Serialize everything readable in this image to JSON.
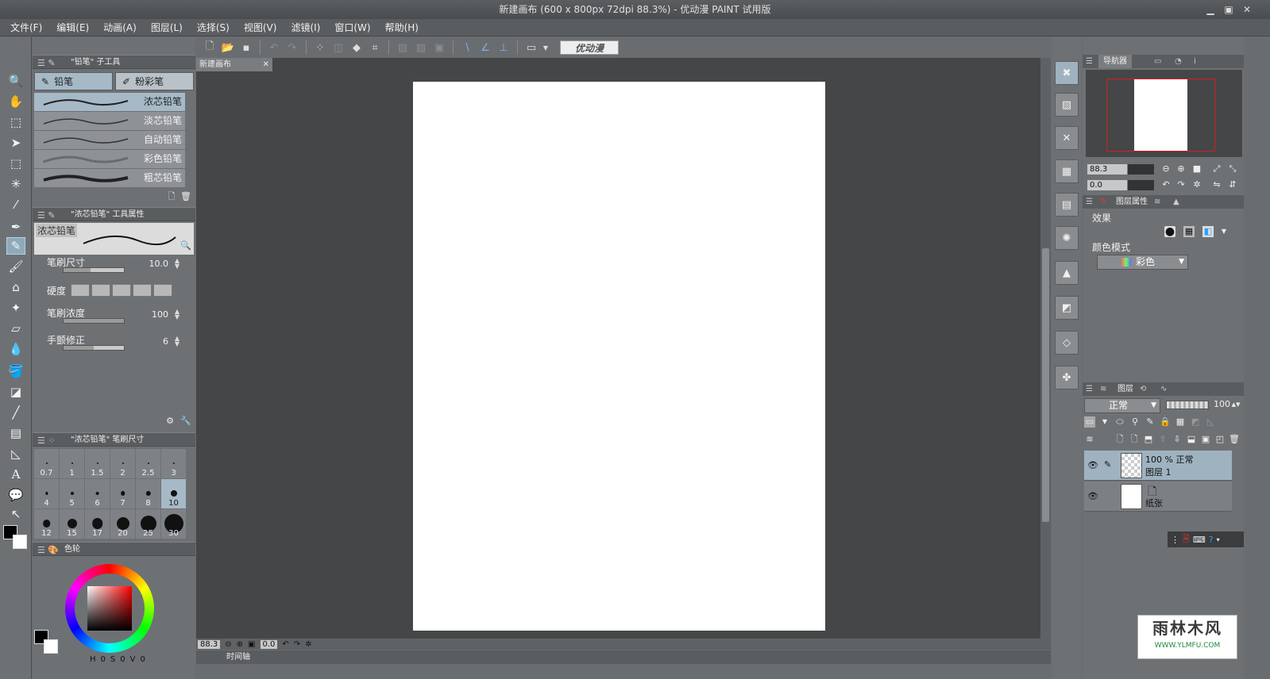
{
  "window": {
    "title": "新建画布 (600 x 800px 72dpi 88.3%)  - 优动漫 PAINT 试用版"
  },
  "menu": [
    "文件(F)",
    "编辑(E)",
    "动画(A)",
    "图层(L)",
    "选择(S)",
    "视图(V)",
    "滤镜(I)",
    "窗口(W)",
    "帮助(H)"
  ],
  "toolbar": {
    "logo_label": "优动漫"
  },
  "subtool_panel": {
    "title": "\"铅笔\" 子工具",
    "tabs": [
      "铅笔",
      "粉彩笔"
    ],
    "brushes": [
      "浓芯铅笔",
      "淡芯铅笔",
      "自动铅笔",
      "彩色铅笔",
      "粗芯铅笔"
    ],
    "active_brush_index": 0
  },
  "tool_property": {
    "title": "\"浓芯铅笔\" 工具属性",
    "preview_label": "浓芯铅笔",
    "brush_size_label": "笔刷尺寸",
    "brush_size_value": "10.0",
    "brush_size_fraction": 0.45,
    "hardness_label": "硬度",
    "density_label": "笔刷浓度",
    "density_value": "100",
    "density_fraction": 1.0,
    "stabilizer_label": "手颤修正",
    "stabilizer_value": "6",
    "stabilizer_fraction": 0.5
  },
  "brush_size_panel": {
    "title": "\"浓芯铅笔\" 笔刷尺寸",
    "sizes": [
      "0.7",
      "1",
      "1.5",
      "2",
      "2.5",
      "3",
      "4",
      "5",
      "6",
      "7",
      "8",
      "10",
      "12",
      "15",
      "17",
      "20",
      "25",
      "30"
    ],
    "active_size": "10"
  },
  "color_panel": {
    "tab_label": "色轮",
    "hsv": [
      "H",
      "0",
      "S",
      "0",
      "V",
      "0"
    ]
  },
  "colors": {
    "main": "#000000",
    "sub": "#ffffff",
    "accent": "#a6b9c7",
    "canvas_bg": "#454647"
  },
  "canvas": {
    "doc_tab": "新建画布",
    "zoom": "88.3",
    "angle": "0.0"
  },
  "timeline": {
    "label": "时间轴"
  },
  "navigator": {
    "tab": "导航器",
    "zoom": "88.3",
    "angle": "0.0"
  },
  "layer_property": {
    "tab": "图层属性",
    "effect_label": "效果",
    "color_mode_label": "颜色模式",
    "color_mode_value": "彩色"
  },
  "layers_panel": {
    "tab": "图层",
    "blend_mode": "正常",
    "opacity": "100",
    "layers": [
      {
        "line1": "100 % 正常",
        "line2": "图层 1"
      },
      {
        "line1": "",
        "line2": "纸张"
      }
    ]
  },
  "watermark": {
    "brand": "雨林木风",
    "url": "WWW.YLMFU.COM"
  }
}
